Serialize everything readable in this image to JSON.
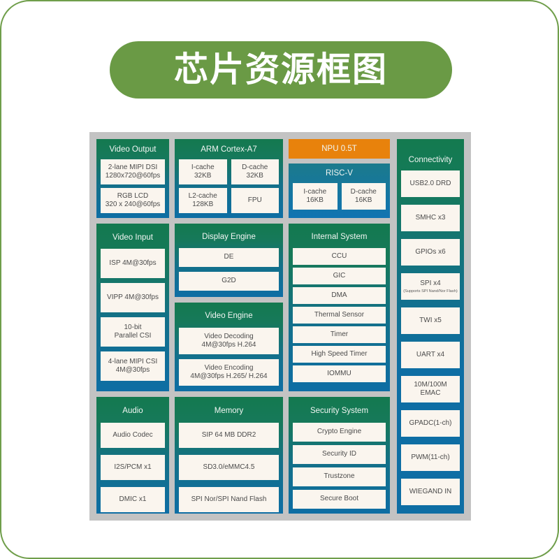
{
  "title": "芯片资源框图",
  "colors": {
    "title_banner": "#6a9a45",
    "page_border": "#6f9e4a",
    "canvas": "#c3c3c3",
    "block_gradient_top": "#14794f",
    "block_gradient_bottom": "#0e6ea4",
    "npu_accent": "#e8820c",
    "cell_bg": "#faf5ee",
    "cell_text": "#4b4b4b"
  },
  "blocks": {
    "video_output": {
      "title": "Video Output",
      "items": [
        "2-lane MIPI DSI\n1280x720@60fps",
        "RGB LCD\n320 x 240@60fps"
      ]
    },
    "arm": {
      "title": "ARM Cortex-A7",
      "items": [
        "I-cache\n32KB",
        "D-cache\n32KB",
        "L2-cache\n128KB",
        "FPU"
      ]
    },
    "npu": {
      "title": "NPU 0.5T"
    },
    "riscv": {
      "title": "RISC-V",
      "items": [
        "I-cache\n16KB",
        "D-cache\n16KB"
      ]
    },
    "connectivity": {
      "title": "Connectivity",
      "items": [
        {
          "label": "USB2.0 DRD",
          "sub": ""
        },
        {
          "label": "SMHC x3",
          "sub": ""
        },
        {
          "label": "GPIOs x6",
          "sub": ""
        },
        {
          "label": "SPI x4",
          "sub": "(Supports SPI Nand/Nor Flash)"
        },
        {
          "label": "TWI x5",
          "sub": ""
        },
        {
          "label": "UART x4",
          "sub": ""
        },
        {
          "label": "10M/100M EMAC",
          "sub": ""
        },
        {
          "label": "GPADC(1-ch)",
          "sub": ""
        },
        {
          "label": "PWM(11-ch)",
          "sub": ""
        },
        {
          "label": "WIEGAND IN",
          "sub": ""
        }
      ]
    },
    "video_input": {
      "title": "Video Input",
      "items": [
        "ISP 4M@30fps",
        "VIPP 4M@30fps",
        "10-bit\nParallel CSI",
        "4-lane MIPI CSI\n4M@30fps"
      ]
    },
    "display_engine": {
      "title": "Display Engine",
      "items": [
        "DE",
        "G2D"
      ]
    },
    "video_engine": {
      "title": "Video Engine",
      "items": [
        "Video Decoding\n4M@30fps H.264",
        "Video Encoding\n4M@30fps H.265/ H.264"
      ]
    },
    "internal_system": {
      "title": "Internal System",
      "items": [
        "CCU",
        "GIC",
        "DMA",
        "Thermal Sensor",
        "Timer",
        "High Speed Timer",
        "IOMMU"
      ]
    },
    "audio": {
      "title": "Audio",
      "items": [
        "Audio Codec",
        "I2S/PCM x1",
        "DMIC x1"
      ]
    },
    "memory": {
      "title": "Memory",
      "items": [
        "SIP 64 MB DDR2",
        "SD3.0/eMMC4.5",
        "SPI Nor/SPI Nand Flash"
      ]
    },
    "security_system": {
      "title": "Security System",
      "items": [
        "Crypto Engine",
        "Security ID",
        "Trustzone",
        "Secure Boot"
      ]
    }
  }
}
